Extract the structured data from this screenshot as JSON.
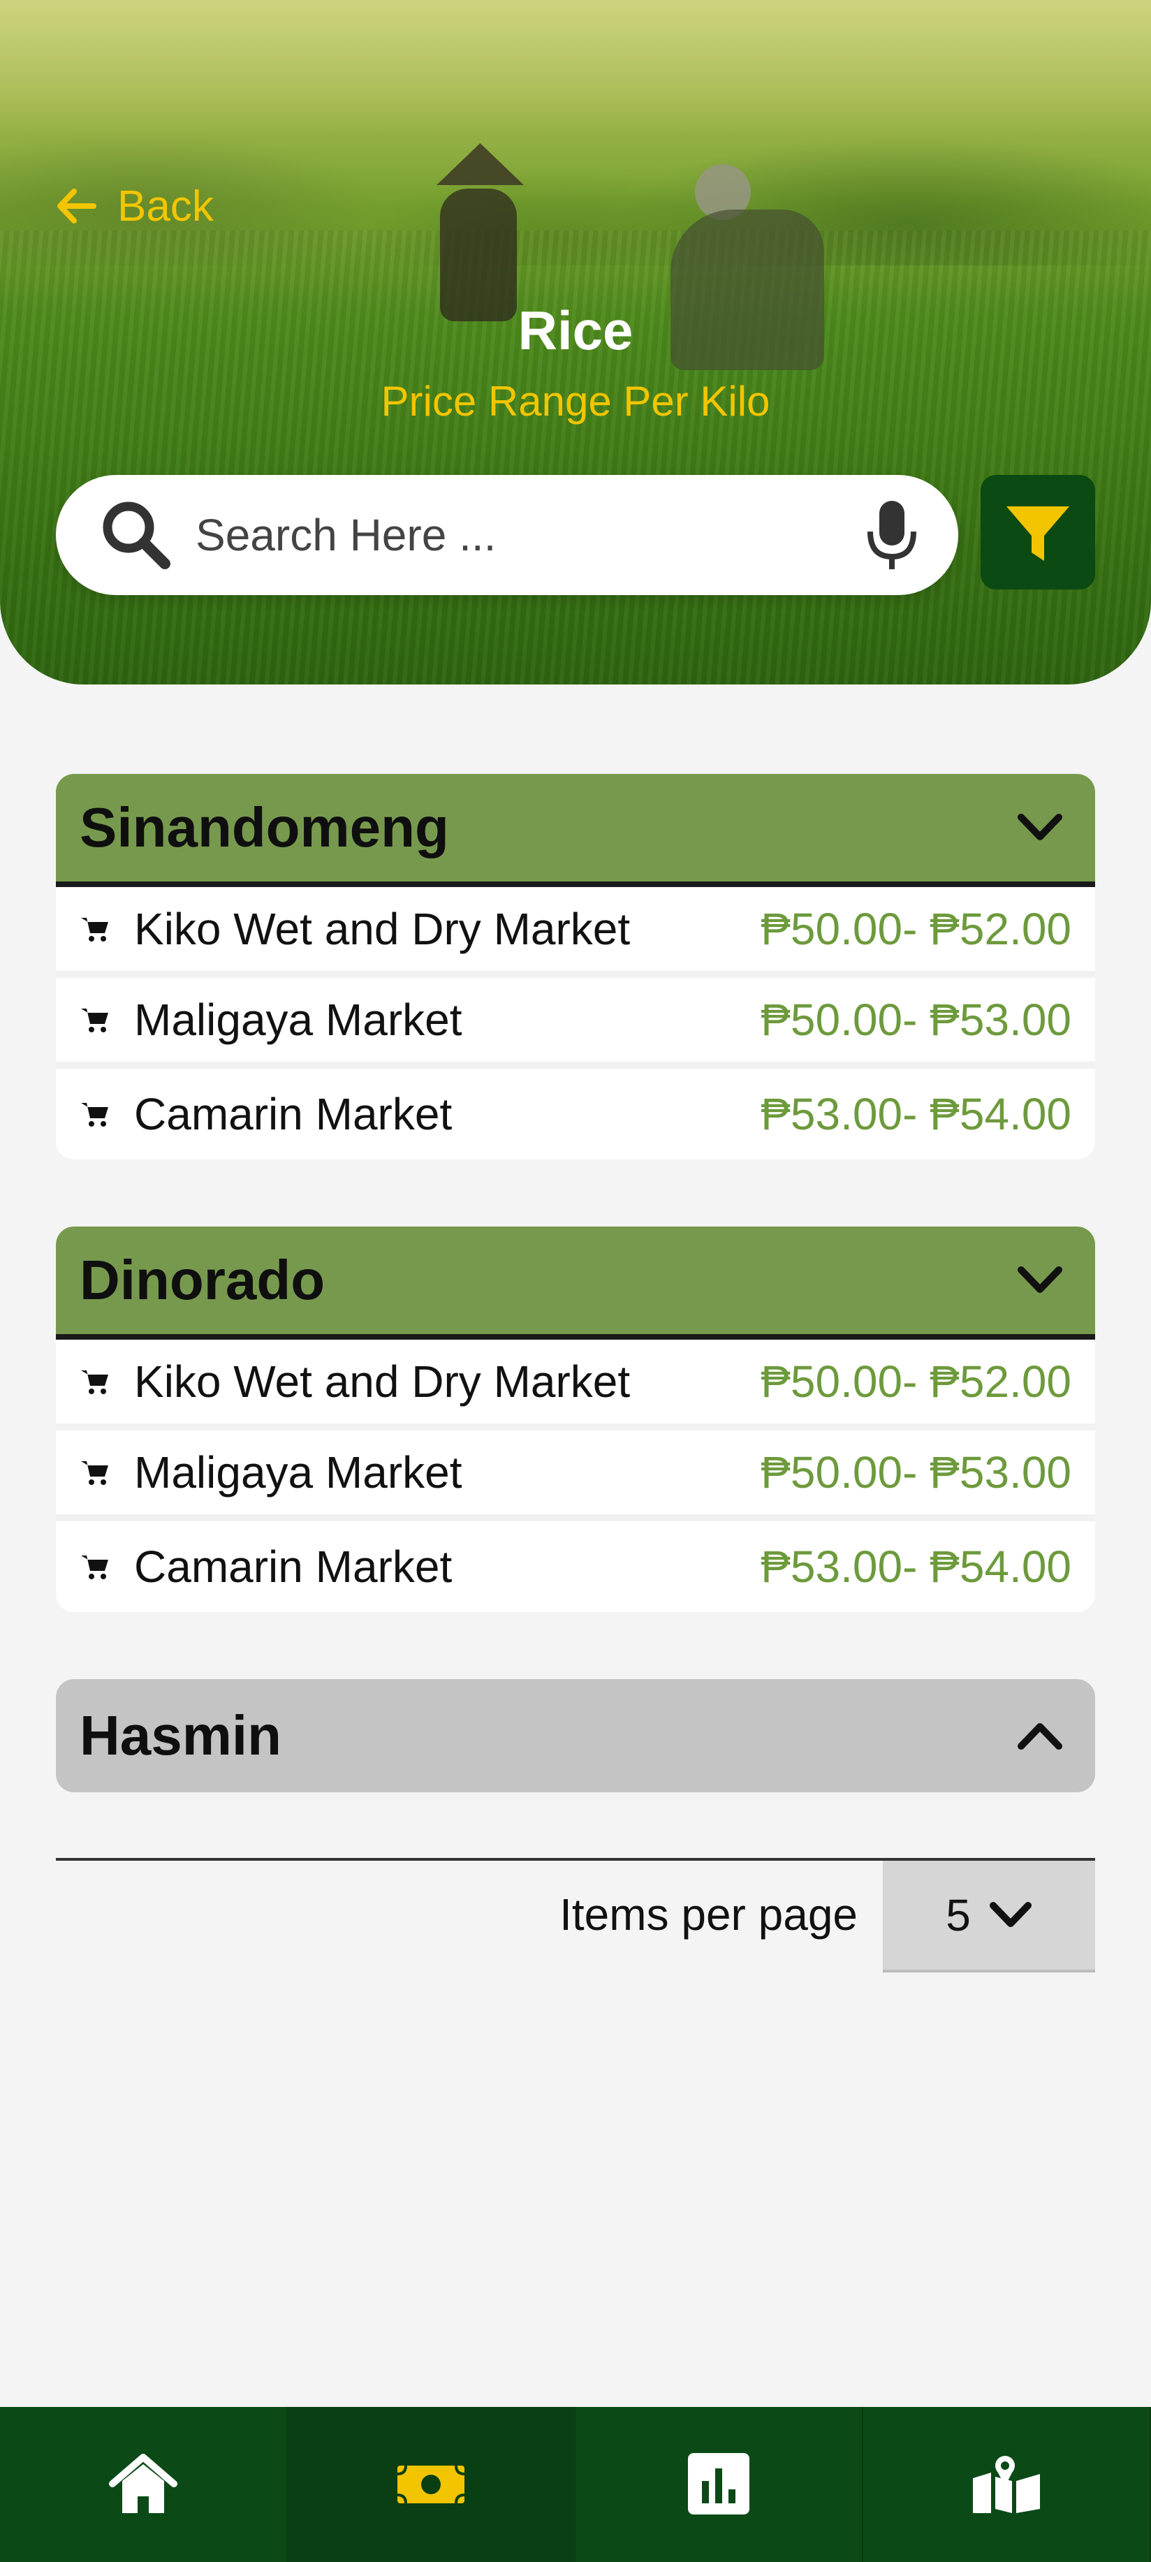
{
  "header": {
    "back_label": "Back",
    "title": "Rice",
    "subtitle": "Price Range Per Kilo"
  },
  "search": {
    "placeholder": "Search Here ..."
  },
  "groups": [
    {
      "name": "Sinandomeng",
      "expanded": true,
      "items": [
        {
          "market": "Kiko Wet and Dry Market",
          "price": "₱50.00- ₱52.00"
        },
        {
          "market": "Maligaya Market",
          "price": "₱50.00- ₱53.00"
        },
        {
          "market": "Camarin Market",
          "price": "₱53.00- ₱54.00"
        }
      ]
    },
    {
      "name": "Dinorado",
      "expanded": true,
      "items": [
        {
          "market": "Kiko Wet and Dry Market",
          "price": "₱50.00- ₱52.00"
        },
        {
          "market": "Maligaya Market",
          "price": "₱50.00- ₱53.00"
        },
        {
          "market": "Camarin Market",
          "price": "₱53.00- ₱54.00"
        }
      ]
    },
    {
      "name": "Hasmin",
      "expanded": false,
      "items": []
    }
  ],
  "pagination": {
    "label": "Items per page",
    "value": "5"
  },
  "nav": [
    {
      "icon": "home-icon",
      "active": false
    },
    {
      "icon": "money-icon",
      "active": true
    },
    {
      "icon": "chart-icon",
      "active": false
    },
    {
      "icon": "map-icon",
      "active": false
    }
  ],
  "colors": {
    "accent_yellow": "#f2c500",
    "dark_green": "#0b4a16",
    "card_header_green": "#77994d",
    "price_green": "#6d9a3c"
  }
}
